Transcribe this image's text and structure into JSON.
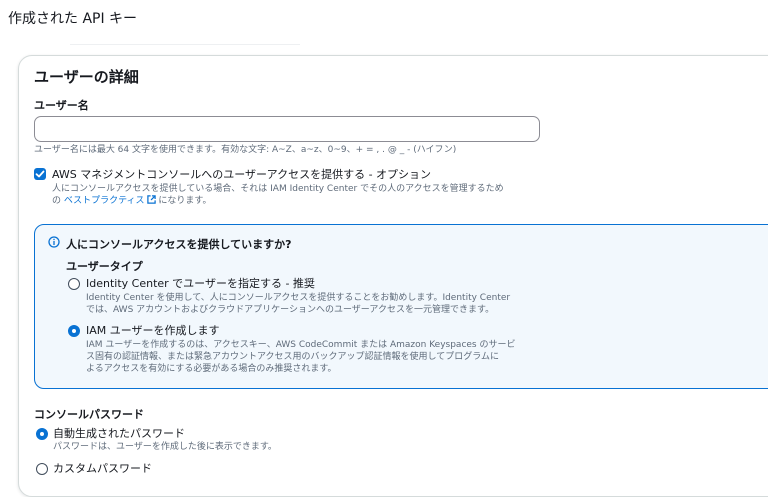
{
  "page": {
    "title": "作成された API キー"
  },
  "user_details": {
    "heading": "ユーザーの詳細",
    "username": {
      "label": "ユーザー名",
      "value": "",
      "hint": "ユーザー名には最大 64 文字を使用できます。有効な文字: A~Z、a~z、0~9、+ = , . @ _ - (ハイフン)"
    },
    "console_access": {
      "checked": true,
      "label": "AWS マネジメントコンソールへのユーザーアクセスを提供する - オプション",
      "desc_line1": "人にコンソールアクセスを提供している場合、それは IAM Identity Center でその人のアクセスを管理するため",
      "desc_prefix": "の",
      "desc_link": "ベストプラクティス",
      "desc_suffix": "になります。"
    }
  },
  "info_panel": {
    "question": "人にコンソールアクセスを提供していますか?",
    "user_type_label": "ユーザータイプ",
    "options": [
      {
        "label": "Identity Center でユーザーを指定する - 推奨",
        "desc_line1": "Identity Center を使用して、人にコンソールアクセスを提供することをお勧めします。Identity Center",
        "desc_line2": "では、AWS アカウントおよびクラウドアプリケーションへのユーザーアクセスを一元管理できます。",
        "selected": false
      },
      {
        "label": "IAM ユーザーを作成します",
        "desc_line1": "IAM ユーザーを作成するのは、アクセスキー、AWS CodeCommit または Amazon Keyspaces のサービ",
        "desc_line2": "ス固有の認証情報、または緊急アカウントアクセス用のバックアップ認証情報を使用してプログラムに",
        "desc_line3": "よるアクセスを有効にする必要がある場合のみ推奨されます。",
        "selected": true
      }
    ]
  },
  "console_password": {
    "label": "コンソールパスワード",
    "options": [
      {
        "label": "自動生成されたパスワード",
        "desc": "パスワードは、ユーザーを作成した後に表示できます。",
        "selected": true
      },
      {
        "label": "カスタムパスワード",
        "selected": false
      }
    ]
  },
  "colors": {
    "accent": "#0972d3",
    "info_bg": "#f2f8fd",
    "hint": "#5f6b7a"
  }
}
